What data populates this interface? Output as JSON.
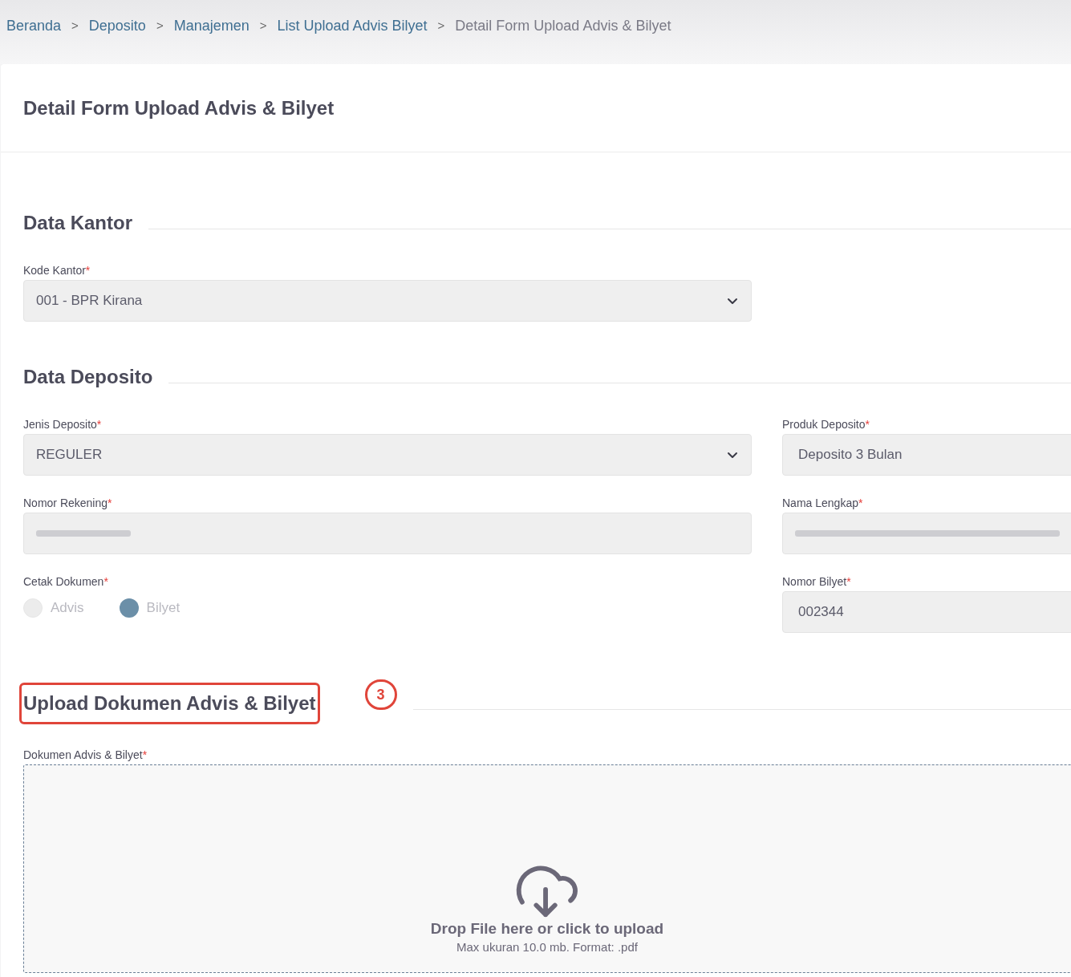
{
  "breadcrumb": [
    {
      "label": "Beranda",
      "current": false
    },
    {
      "label": "Deposito",
      "current": false
    },
    {
      "label": "Manajemen",
      "current": false
    },
    {
      "label": "List Upload Advis Bilyet",
      "current": false
    },
    {
      "label": "Detail Form Upload Advis & Bilyet",
      "current": true
    }
  ],
  "breadcrumb_separator": ">",
  "page_title": "Detail Form Upload Advis & Bilyet",
  "sections": [
    {
      "title": "Data Kantor",
      "highlighted": false,
      "fields": [
        {
          "kind": "select",
          "label": "Kode Kantor",
          "required_mark": "*",
          "value": "001 - BPR Kirana"
        }
      ]
    },
    {
      "title": "Data Deposito",
      "highlighted": false,
      "fields": [
        {
          "kind": "select",
          "label": "Jenis Deposito",
          "required_mark": "*",
          "value": "REGULER"
        },
        {
          "kind": "text",
          "label": "Produk Deposito",
          "required_mark": "*",
          "value": "Deposito 3 Bulan"
        },
        {
          "kind": "redacted",
          "label": "Nomor Rekening",
          "required_mark": "*"
        },
        {
          "kind": "redacted",
          "label": "Nama Lengkap",
          "required_mark": "*"
        },
        {
          "kind": "radio",
          "label": "Cetak Dokumen",
          "required_mark": "*",
          "options": [
            {
              "label": "Advis",
              "selected": false
            },
            {
              "label": "Bilyet",
              "selected": true
            }
          ]
        },
        {
          "kind": "text",
          "label": "Nomor Bilyet",
          "required_mark": "*",
          "value": "002344"
        }
      ]
    },
    {
      "title": "Upload Dokumen Advis & Bilyet",
      "highlighted": true,
      "marker": "3",
      "fields": [
        {
          "kind": "upload",
          "label": "Dokumen Advis & Bilyet",
          "required_mark": "*",
          "prompt": "Drop File here or click to upload",
          "hint": "Max ukuran 10.0 mb. Format: .pdf"
        }
      ]
    }
  ]
}
